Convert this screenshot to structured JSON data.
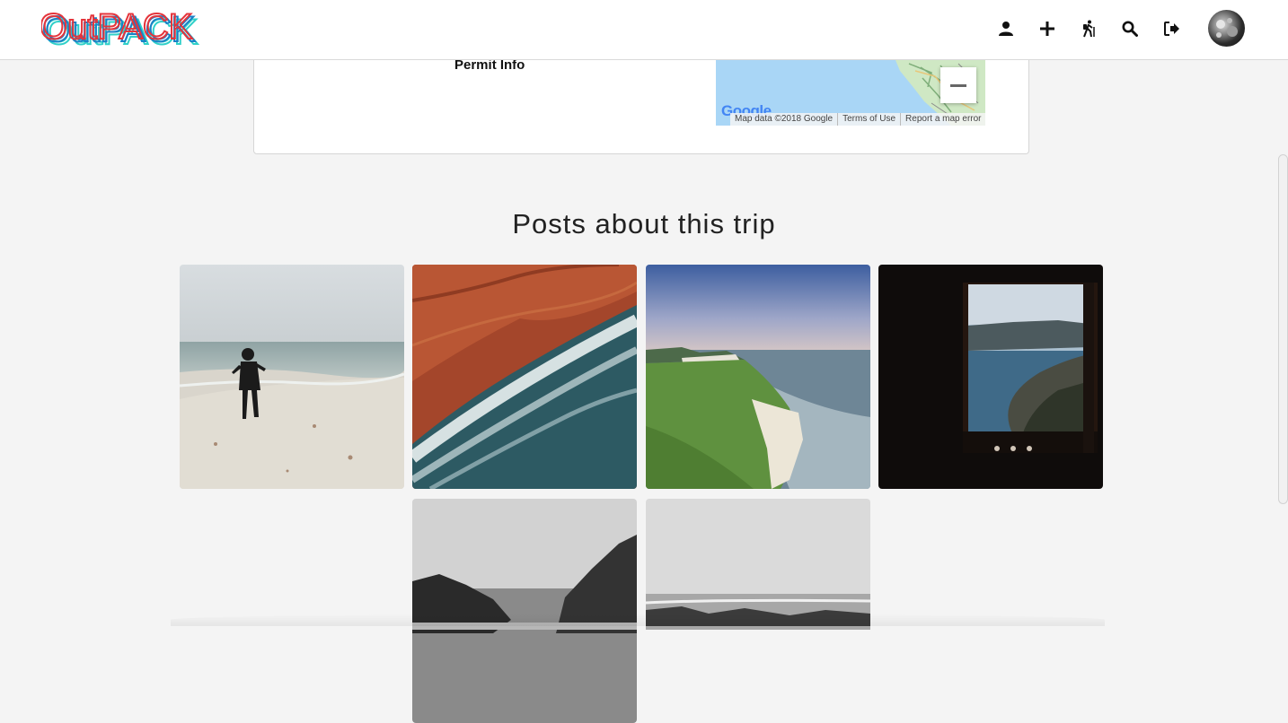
{
  "app": {
    "logo_text": "OutPACK",
    "colors": {
      "logo_red": "#e4343b",
      "logo_blue": "#1b7fc6",
      "logo_cyan": "#2fd0c9",
      "header_bg": "#ffffff",
      "page_bg": "#f4f4f4"
    }
  },
  "header": {
    "icons": [
      "user-icon",
      "plus-icon",
      "hiker-icon",
      "search-icon",
      "sign-out-icon"
    ],
    "avatar": "avatar"
  },
  "trip": {
    "permit_label": "Permit Info",
    "map": {
      "google_label": "Google",
      "attribution": "Map data ©2018 Google",
      "terms": "Terms of Use",
      "report": "Report a map error"
    }
  },
  "posts": {
    "title": "Posts about this trip",
    "items": [
      {
        "subject": "woman walking on beach"
      },
      {
        "subject": "aerial red sand and surf"
      },
      {
        "subject": "white cliffs by the sea"
      },
      {
        "subject": "window view of coast"
      },
      {
        "subject": "black and white cliffs"
      },
      {
        "subject": "black and white ocean"
      }
    ]
  }
}
